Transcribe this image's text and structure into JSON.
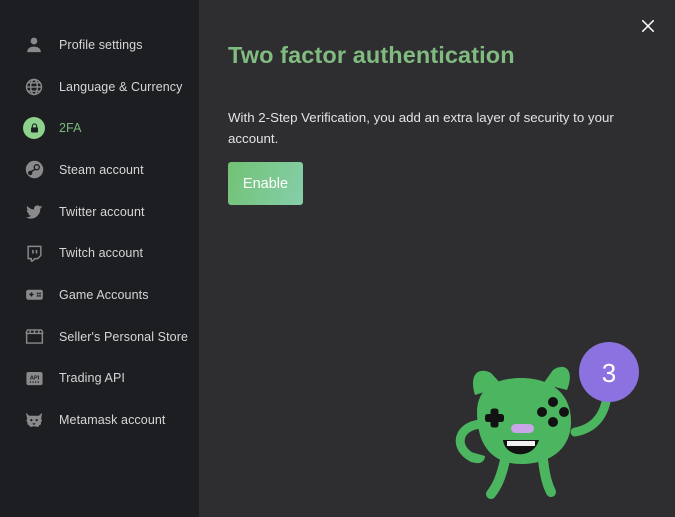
{
  "sidebar": {
    "items": [
      {
        "label": "Profile settings",
        "icon": "person-icon",
        "active": false
      },
      {
        "label": "Language & Currency",
        "icon": "globe-icon",
        "active": false
      },
      {
        "label": "2FA",
        "icon": "lock-icon",
        "active": true
      },
      {
        "label": "Steam account",
        "icon": "steam-icon",
        "active": false
      },
      {
        "label": "Twitter account",
        "icon": "twitter-icon",
        "active": false
      },
      {
        "label": "Twitch account",
        "icon": "twitch-icon",
        "active": false
      },
      {
        "label": "Game Accounts",
        "icon": "gamepad-icon",
        "active": false
      },
      {
        "label": "Seller's Personal Store",
        "icon": "store-icon",
        "active": false
      },
      {
        "label": "Trading API",
        "icon": "api-icon",
        "active": false
      },
      {
        "label": "Metamask account",
        "icon": "fox-icon",
        "active": false
      }
    ]
  },
  "main": {
    "title": "Two factor authentication",
    "description": "With 2-Step Verification, you add an extra layer of security to your account.",
    "enable_label": "Enable",
    "close_icon": "close-icon"
  },
  "mascot": {
    "badge_value": "3",
    "badge_color": "#8b72e0",
    "body_color": "#4cb560",
    "nose_color": "#c9a6e8"
  },
  "colors": {
    "accent_green": "#80bb80",
    "sidebar_bg": "#1d1e21",
    "main_bg": "#2e2e30",
    "active_icon_bg": "#8cd18c"
  }
}
